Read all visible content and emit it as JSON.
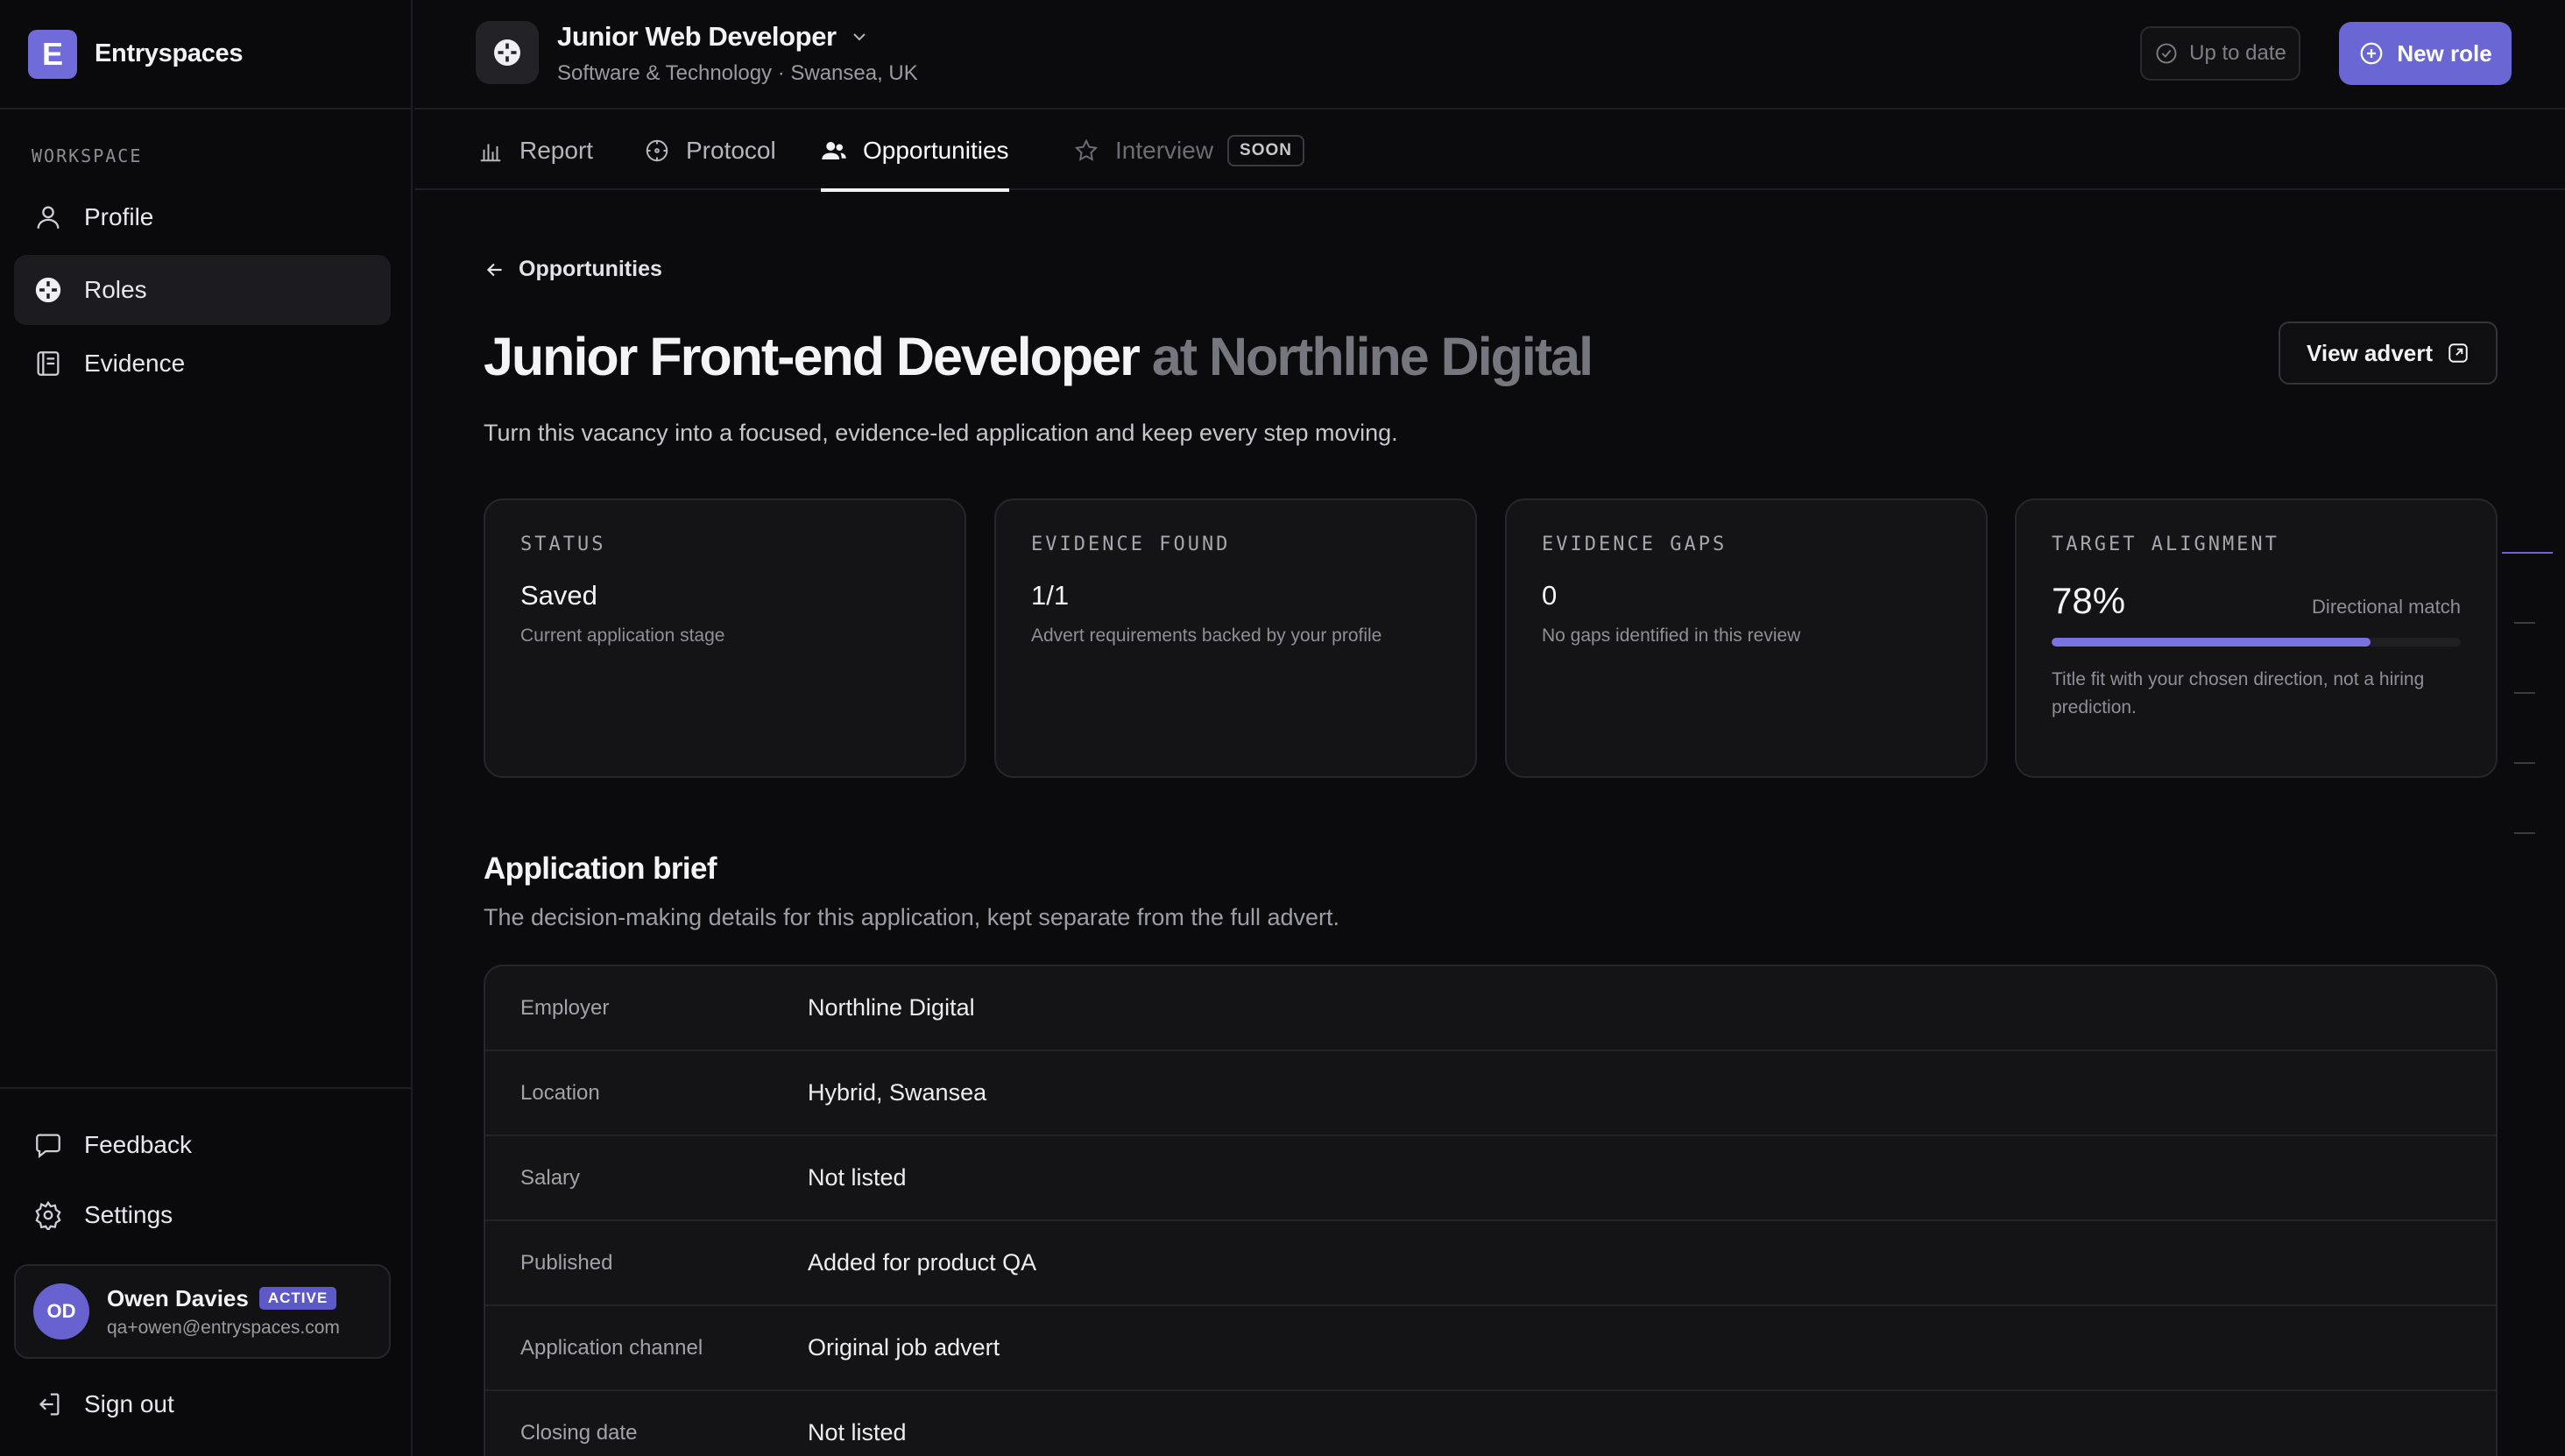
{
  "brand": {
    "name": "Entryspaces",
    "logo_letter": "E"
  },
  "sidebar": {
    "section_label": "WORKSPACE",
    "items": [
      {
        "label": "Profile",
        "icon": "user-icon",
        "active": false
      },
      {
        "label": "Roles",
        "icon": "roles-icon",
        "active": true
      },
      {
        "label": "Evidence",
        "icon": "notebook-icon",
        "active": false
      }
    ],
    "bottom_items": [
      {
        "label": "Feedback",
        "icon": "chat-bubble-icon"
      },
      {
        "label": "Settings",
        "icon": "gear-icon"
      }
    ],
    "user": {
      "initials": "OD",
      "name": "Owen Davies",
      "badge": "ACTIVE",
      "email": "qa+owen@entryspaces.com"
    },
    "sign_out": "Sign out"
  },
  "header": {
    "role_title": "Junior Web Developer",
    "role_subtitle": "Software & Technology · Swansea, UK",
    "status_button": "Up to date",
    "new_role_button": "New role"
  },
  "tabs": [
    {
      "label": "Report",
      "icon": "bar-chart-icon",
      "state": "normal"
    },
    {
      "label": "Protocol",
      "icon": "compass-icon",
      "state": "normal"
    },
    {
      "label": "Opportunities",
      "icon": "people-icon",
      "state": "active"
    },
    {
      "label": "Interview",
      "icon": "star-icon",
      "state": "disabled",
      "badge": "SOON"
    }
  ],
  "page": {
    "back_label": "Opportunities",
    "title_main": "Junior Front-end Developer",
    "title_muted": "at Northline Digital",
    "description": "Turn this vacancy into a focused, evidence-led application and keep every step moving.",
    "view_advert": "View advert"
  },
  "cards": {
    "status": {
      "label": "STATUS",
      "value": "Saved",
      "note": "Current application stage"
    },
    "evidence_found": {
      "label": "EVIDENCE FOUND",
      "value": "1/1",
      "note": "Advert requirements backed by your profile"
    },
    "evidence_gaps": {
      "label": "EVIDENCE GAPS",
      "value": "0",
      "note": "No gaps identified in this review"
    },
    "alignment": {
      "label": "TARGET ALIGNMENT",
      "value": "78%",
      "percent": 78,
      "tag": "Directional match",
      "note": "Title fit with your chosen direction, not a hiring prediction."
    }
  },
  "brief": {
    "title": "Application brief",
    "description": "The decision-making details for this application, kept separate from the full advert.",
    "rows": [
      {
        "key": "Employer",
        "value": "Northline Digital"
      },
      {
        "key": "Location",
        "value": "Hybrid, Swansea"
      },
      {
        "key": "Salary",
        "value": "Not listed"
      },
      {
        "key": "Published",
        "value": "Added for product QA"
      },
      {
        "key": "Application channel",
        "value": "Original job advert"
      },
      {
        "key": "Closing date",
        "value": "Not listed"
      }
    ]
  },
  "colors": {
    "accent": "#6a66d4",
    "background": "#0b0b0d",
    "card": "#141417"
  }
}
